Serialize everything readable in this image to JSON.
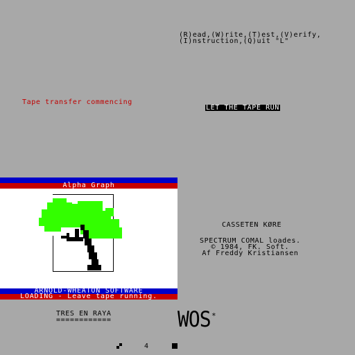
{
  "menu": {
    "line1": "(R)ead,(W)rite,(T)est,(V)erify,",
    "line2": "(I)nstruction,(Q)uit \"L\""
  },
  "status": {
    "commencing": "Tape transfer commencing",
    "tape_run": "LET THE TAPE RUN"
  },
  "loading_screen": {
    "title": "Alpha Graph",
    "publisher": "ARNOLD-WHEATON SOFTWARE",
    "loading_msg": "LOADING - Leave tape running."
  },
  "right_panel": {
    "casseten": "CASSETEN KØRE",
    "comal_line1": "SPECTRUM COMAL loades.",
    "comal_line2": "© 1984, FK. Soft.",
    "comal_line3": "Af Freddy Kristiansen"
  },
  "bottom": {
    "tres": "TRES EN RAYA",
    "tres_underline": "============",
    "logo": "WOS",
    "logo_mark": "*",
    "page": "4"
  },
  "colors": {
    "background": "#a8a8a8",
    "red": "#c00000",
    "blue": "#0000c8",
    "tree_green": "#33ff00"
  }
}
